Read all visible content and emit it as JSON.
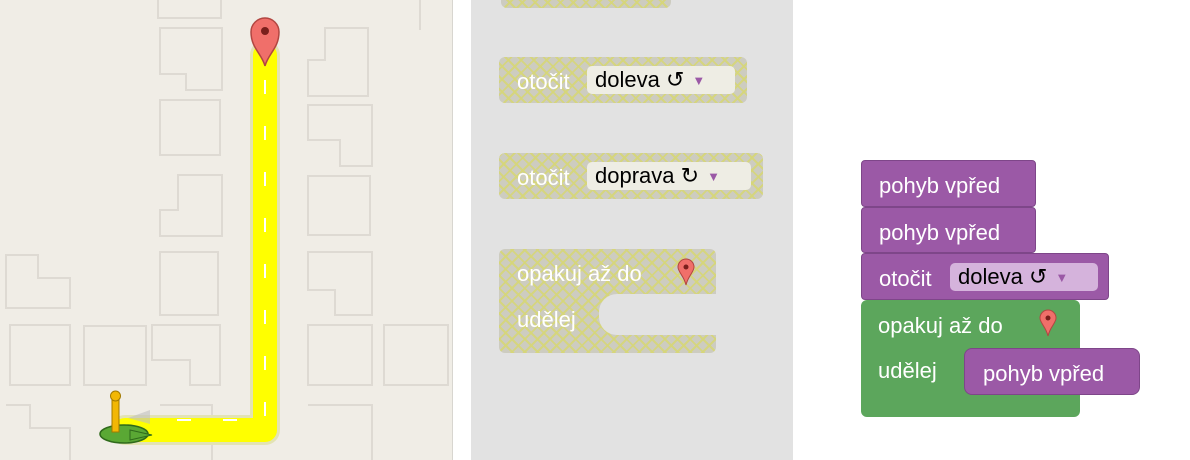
{
  "toolbox": {
    "turn_left": {
      "label": "otočit",
      "value": "doleva ↺"
    },
    "turn_right": {
      "label": "otočit",
      "value": "doprava ↻"
    },
    "repeat": {
      "label": "opakuj až do",
      "do_label": "udělej"
    }
  },
  "workspace": {
    "move_1": "pohyb vpřed",
    "move_2": "pohyb vpřed",
    "turn": {
      "label": "otočit",
      "value": "doleva ↺"
    },
    "repeat": {
      "label": "opakuj až do",
      "do_label": "udělej"
    },
    "inner_move": "pohyb vpřed"
  },
  "colors": {
    "map_bg": "#f0ede6",
    "road": "#ffff00",
    "marker": "#f06f6a",
    "motion_block": "#9b59a6",
    "loop_block": "#5ca65c",
    "toolbox_bg": "#e2e2e2"
  },
  "icons": [
    "goal-marker-icon",
    "pegman-icon",
    "marker-icon"
  ]
}
